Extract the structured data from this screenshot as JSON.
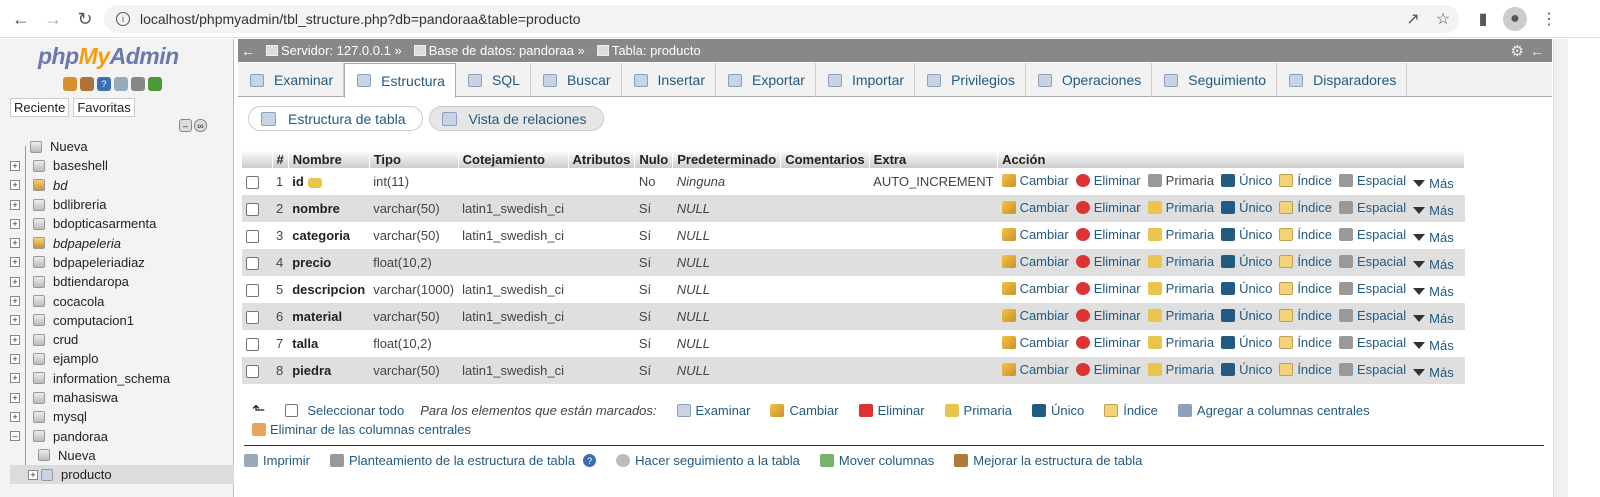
{
  "browser": {
    "url": "localhost/phpmyadmin/tbl_structure.php?db=pandoraa&table=producto"
  },
  "logo": {
    "php": "php",
    "my": "My",
    "admin": "Admin"
  },
  "left_tabs": [
    "Reciente",
    "Favoritas"
  ],
  "tree": [
    {
      "label": "Nueva",
      "type": "new"
    },
    {
      "label": "baseshell",
      "type": "db"
    },
    {
      "label": "bd",
      "type": "db",
      "italic": true,
      "star": true
    },
    {
      "label": "bdlibreria",
      "type": "db"
    },
    {
      "label": "bdopticasarmenta",
      "type": "db"
    },
    {
      "label": "bdpapeleria",
      "type": "db",
      "italic": true,
      "star": true
    },
    {
      "label": "bdpapeleriadiaz",
      "type": "db"
    },
    {
      "label": "bdtiendaropa",
      "type": "db"
    },
    {
      "label": "cocacola",
      "type": "db"
    },
    {
      "label": "computacion1",
      "type": "db"
    },
    {
      "label": "crud",
      "type": "db"
    },
    {
      "label": "ejamplo",
      "type": "db"
    },
    {
      "label": "information_schema",
      "type": "db"
    },
    {
      "label": "mahasiswa",
      "type": "db"
    },
    {
      "label": "mysql",
      "type": "db"
    },
    {
      "label": "pandoraa",
      "type": "db",
      "expanded": true
    },
    {
      "label": "Nueva",
      "type": "child-new"
    },
    {
      "label": "producto",
      "type": "child",
      "selected": true
    }
  ],
  "breadcrumb": {
    "server": "Servidor: 127.0.0.1 »",
    "database": "Base de datos: pandoraa »",
    "table": "Tabla: producto"
  },
  "tabs": [
    "Examinar",
    "Estructura",
    "SQL",
    "Buscar",
    "Insertar",
    "Exportar",
    "Importar",
    "Privilegios",
    "Operaciones",
    "Seguimiento",
    "Disparadores"
  ],
  "active_tab": "Estructura",
  "subtabs": [
    "Estructura de tabla",
    "Vista de relaciones"
  ],
  "columns": [
    "#",
    "Nombre",
    "Tipo",
    "Cotejamiento",
    "Atributos",
    "Nulo",
    "Predeterminado",
    "Comentarios",
    "Extra",
    "Acción"
  ],
  "rows": [
    {
      "n": "1",
      "name": "id",
      "type": "int(11)",
      "coll": "",
      "attr": "",
      "null": "No",
      "def": "Ninguna",
      "comm": "",
      "extra": "AUTO_INCREMENT",
      "pk": true
    },
    {
      "n": "2",
      "name": "nombre",
      "type": "varchar(50)",
      "coll": "latin1_swedish_ci",
      "attr": "",
      "null": "Sí",
      "def": "NULL",
      "comm": "",
      "extra": ""
    },
    {
      "n": "3",
      "name": "categoria",
      "type": "varchar(50)",
      "coll": "latin1_swedish_ci",
      "attr": "",
      "null": "Sí",
      "def": "NULL",
      "comm": "",
      "extra": ""
    },
    {
      "n": "4",
      "name": "precio",
      "type": "float(10,2)",
      "coll": "",
      "attr": "",
      "null": "Sí",
      "def": "NULL",
      "comm": "",
      "extra": ""
    },
    {
      "n": "5",
      "name": "descripcion",
      "type": "varchar(1000)",
      "coll": "latin1_swedish_ci",
      "attr": "",
      "null": "Sí",
      "def": "NULL",
      "comm": "",
      "extra": ""
    },
    {
      "n": "6",
      "name": "material",
      "type": "varchar(50)",
      "coll": "latin1_swedish_ci",
      "attr": "",
      "null": "Sí",
      "def": "NULL",
      "comm": "",
      "extra": ""
    },
    {
      "n": "7",
      "name": "talla",
      "type": "float(10,2)",
      "coll": "",
      "attr": "",
      "null": "Sí",
      "def": "NULL",
      "comm": "",
      "extra": ""
    },
    {
      "n": "8",
      "name": "piedra",
      "type": "varchar(50)",
      "coll": "latin1_swedish_ci",
      "attr": "",
      "null": "Sí",
      "def": "NULL",
      "comm": "",
      "extra": ""
    }
  ],
  "row_actions": [
    "Cambiar",
    "Eliminar",
    "Primaria",
    "Único",
    "Índice",
    "Espacial",
    "Más"
  ],
  "footer": {
    "select_all": "Seleccionar todo",
    "with_selected": "Para los elementos que están marcados:",
    "actions": [
      "Examinar",
      "Cambiar",
      "Eliminar",
      "Primaria",
      "Único",
      "Índice",
      "Agregar a columnas centrales"
    ],
    "remove_central": "Eliminar de las columnas centrales"
  },
  "bottom_links": [
    "Imprimir",
    "Planteamiento de la estructura de tabla",
    "Hacer seguimiento a la tabla",
    "Mover columnas",
    "Mejorar la estructura de tabla"
  ]
}
